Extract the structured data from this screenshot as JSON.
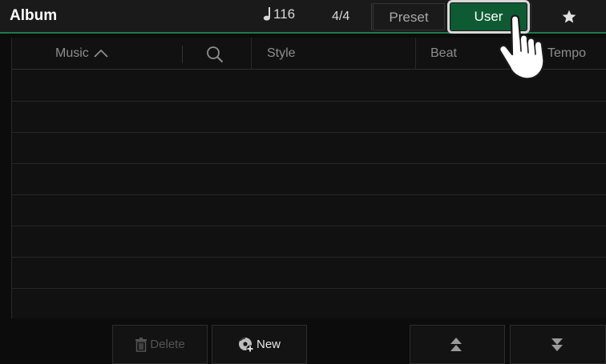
{
  "header": {
    "title": "Album",
    "tempo": "116",
    "tempo_icon": "quarter-note-icon",
    "time_signature": "4/4",
    "tabs": [
      {
        "label": "Preset",
        "selected": false
      },
      {
        "label": "User",
        "selected": true
      },
      {
        "icon": "star-icon",
        "selected": false
      }
    ]
  },
  "table": {
    "columns": [
      {
        "label": "Music",
        "sort": "ascending"
      },
      {
        "icon": "search-icon"
      },
      {
        "label": "Style"
      },
      {
        "label": "Beat"
      },
      {
        "label": "Tempo"
      }
    ],
    "rows": []
  },
  "footer": {
    "delete_label": "Delete",
    "delete_enabled": false,
    "new_label": "New",
    "move_up_icon": "double-chevron-up-icon",
    "move_down_icon": "double-chevron-down-icon"
  },
  "colors": {
    "accent": "#1d7a48",
    "selected_tab": "#0e5a33",
    "background": "#0c0c0c"
  }
}
